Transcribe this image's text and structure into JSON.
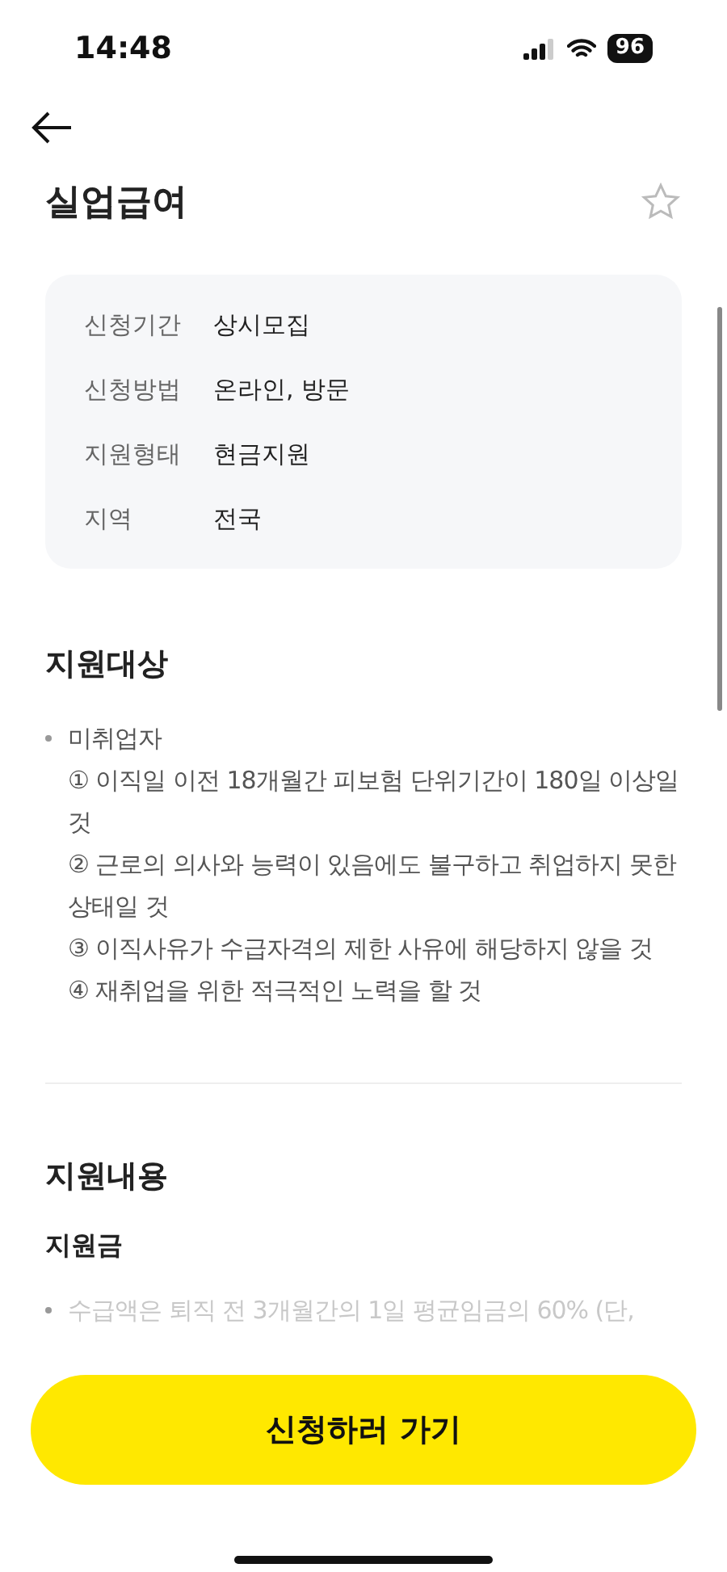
{
  "status_bar": {
    "time": "14:48",
    "battery": "96"
  },
  "header": {
    "title": "실업급여",
    "favorited": false
  },
  "info": [
    {
      "label": "신청기간",
      "value": "상시모집"
    },
    {
      "label": "신청방법",
      "value": "온라인, 방문"
    },
    {
      "label": "지원형태",
      "value": "현금지원"
    },
    {
      "label": "지역",
      "value": "전국"
    }
  ],
  "sections": [
    {
      "title": "지원대상",
      "bullets": [
        {
          "text": "미취업자",
          "lines": [
            "① 이직일 이전 18개월간 피보험 단위기간이 180일 이상일 것",
            "② 근로의 의사와 능력이 있음에도 불구하고 취업하지 못한 상태일 것",
            "③ 이직사유가 수급자격의 제한 사유에 해당하지 않을 것",
            "④ 재취업을 위한 적극적인 노력을 할 것"
          ]
        }
      ]
    },
    {
      "title": "지원내용",
      "subtitle": "지원금",
      "bullets": [
        {
          "text": "수급액은 퇴직 전 3개월간의 1일 평균임금의 60% (단,",
          "faded": true
        }
      ]
    }
  ],
  "apply_button": "신청하러 가기"
}
